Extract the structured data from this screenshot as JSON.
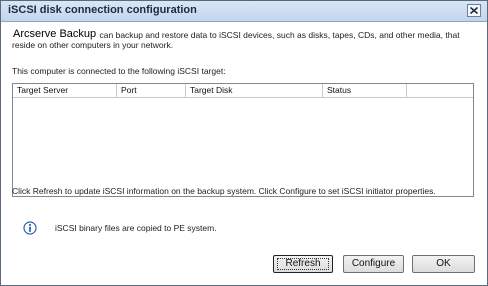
{
  "window": {
    "title": "iSCSI disk connection configuration"
  },
  "intro": {
    "brand": "Arcserve Backup",
    "text": "can backup and restore data to iSCSI devices, such as disks, tapes, CDs, and other media, that reside on other computers in your network."
  },
  "connected_label": "This computer is connected to the following iSCSI target:",
  "table": {
    "columns": [
      "Target Server",
      "Port",
      "Target Disk",
      "Status",
      ""
    ],
    "rows": []
  },
  "refresh_note": "Click Refresh to update iSCSI information on the backup system. Click Configure to set iSCSI initiator properties.",
  "info": {
    "icon": "info-icon",
    "text": "iSCSI binary files are copied to PE system."
  },
  "buttons": {
    "refresh": "Refresh",
    "configure": "Configure",
    "ok": "OK"
  },
  "icons": {
    "close": "close-icon"
  }
}
